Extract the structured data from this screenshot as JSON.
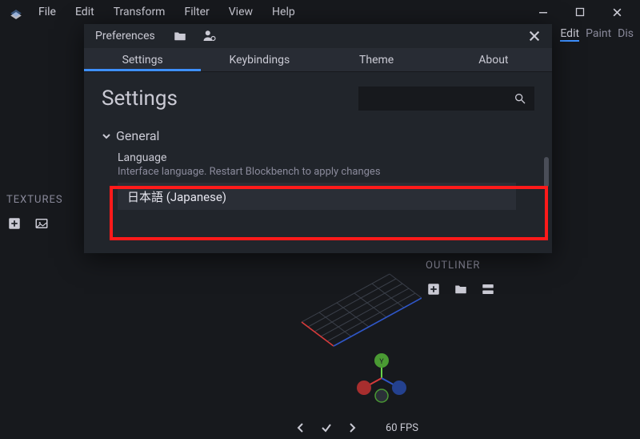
{
  "menubar": [
    "File",
    "Edit",
    "Transform",
    "Filter",
    "View",
    "Help"
  ],
  "toolbar_under": {
    "edit": "Edit",
    "paint": "Paint",
    "display": "Dis"
  },
  "textures": {
    "header": "TEXTURES"
  },
  "outliner": {
    "header": "OUTLINER"
  },
  "statusbar": {
    "fps": "60 FPS"
  },
  "dialog": {
    "title": "Preferences",
    "tabs": {
      "settings": "Settings",
      "keybindings": "Keybindings",
      "theme": "Theme",
      "about": "About"
    },
    "settings_heading": "Settings",
    "section_general": "General",
    "setting_language": {
      "label": "Language",
      "hint": "Interface language. Restart Blockbench to apply changes",
      "value": "日本語 (Japanese)"
    }
  }
}
